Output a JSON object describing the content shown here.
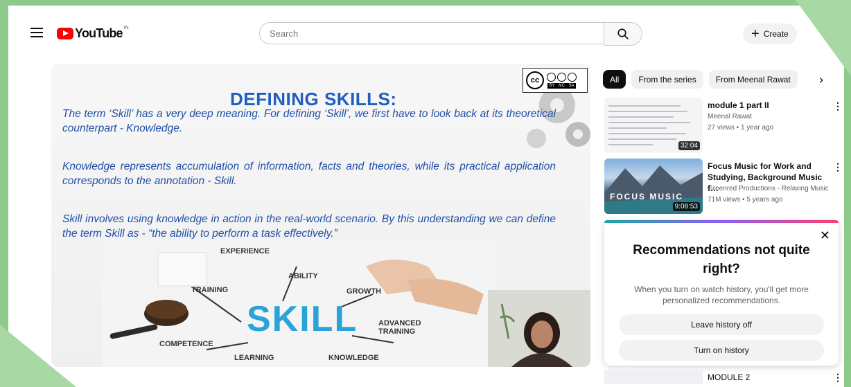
{
  "header": {
    "logo_text": "YouTube",
    "logo_region": "IN",
    "search_placeholder": "Search",
    "create_label": "Create"
  },
  "slide": {
    "title": "DEFINING SKILLS:",
    "paragraphs": [
      "The term ‘Skill’ has a very deep meaning. For defining ‘Skill’, we first have to look back at its theoretical counterpart - Knowledge.",
      "Knowledge represents accumulation of information, facts and theories, while its practical application corresponds to the annotation - Skill.",
      "Skill involves using knowledge in action in the real-world scenario. By this understanding we can define the term Skill as - “the ability to perform a task effectively.”"
    ],
    "license": {
      "cc": "cc",
      "labels": "BY NC SA"
    },
    "image": {
      "main_word": "SKILL",
      "keywords": [
        "EXPERIENCE",
        "ABILITY",
        "TRAINING",
        "GROWTH",
        "ADVANCED TRAINING",
        "COMPETENCE",
        "LEARNING",
        "KNOWLEDGE"
      ]
    }
  },
  "chips": [
    "All",
    "From the series",
    "From Meenal Rawat"
  ],
  "recommendations": [
    {
      "title": "module 1 part II",
      "channel": "Meenal Rawat",
      "meta": "27 views • 1 year ago",
      "duration": "32:04"
    },
    {
      "title": "Focus Music for Work and Studying, Background Music f…",
      "channel": "Greenred Productions - Relaxing Music",
      "meta": "71M views • 5 years ago",
      "duration": "9:08:53",
      "thumb_text": "FOCUS MUSIC"
    },
    {
      "title": "MODULE 2"
    }
  ],
  "popup": {
    "title": "Recommendations not quite right?",
    "text": "When you turn on watch history, you'll get more personalized recommendations.",
    "btn_off": "Leave history off",
    "btn_on": "Turn on history"
  },
  "colors": {
    "brand_red": "#ff0000",
    "slide_blue": "#1f5fbf",
    "skill_blue": "#2aa3d8"
  }
}
